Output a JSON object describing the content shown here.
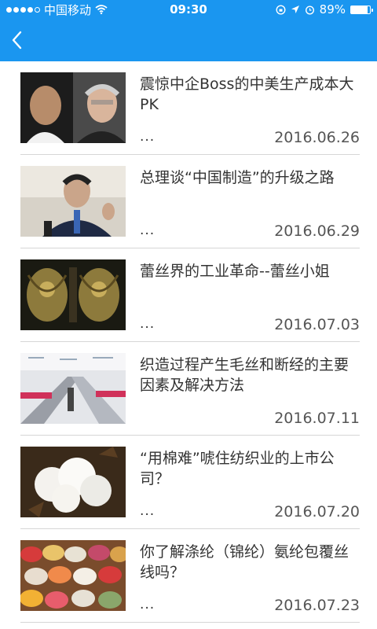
{
  "status_bar": {
    "carrier": "中国移动",
    "time": "09:30",
    "battery": "89%",
    "battery_level": 0.89,
    "signal_bars_filled": 4,
    "signal_bars_total": 5
  },
  "nav": {
    "back_icon": "chevron-left-icon",
    "color": "#1a96f0"
  },
  "articles": [
    {
      "title": "震惊中企Boss的中美生产成本大PK",
      "ellipsis": "...",
      "date": "2016.06.26"
    },
    {
      "title": "总理谈“中国制造”的升级之路",
      "ellipsis": "...",
      "date": "2016.06.29"
    },
    {
      "title": "蕾丝界的工业革命--蕾丝小姐",
      "ellipsis": "...",
      "date": "2016.07.03"
    },
    {
      "title": "织造过程产生毛丝和断经的主要因素及解决方法",
      "ellipsis": "...",
      "date": "2016.07.11"
    },
    {
      "title": "“用棉难”唬住纺织业的上市公司？",
      "ellipsis": "...",
      "date": "2016.07.20"
    },
    {
      "title": "你了解涤纶（锦纶）氨纶包覆丝线吗？",
      "ellipsis": "...",
      "date": "2016.07.23"
    }
  ]
}
